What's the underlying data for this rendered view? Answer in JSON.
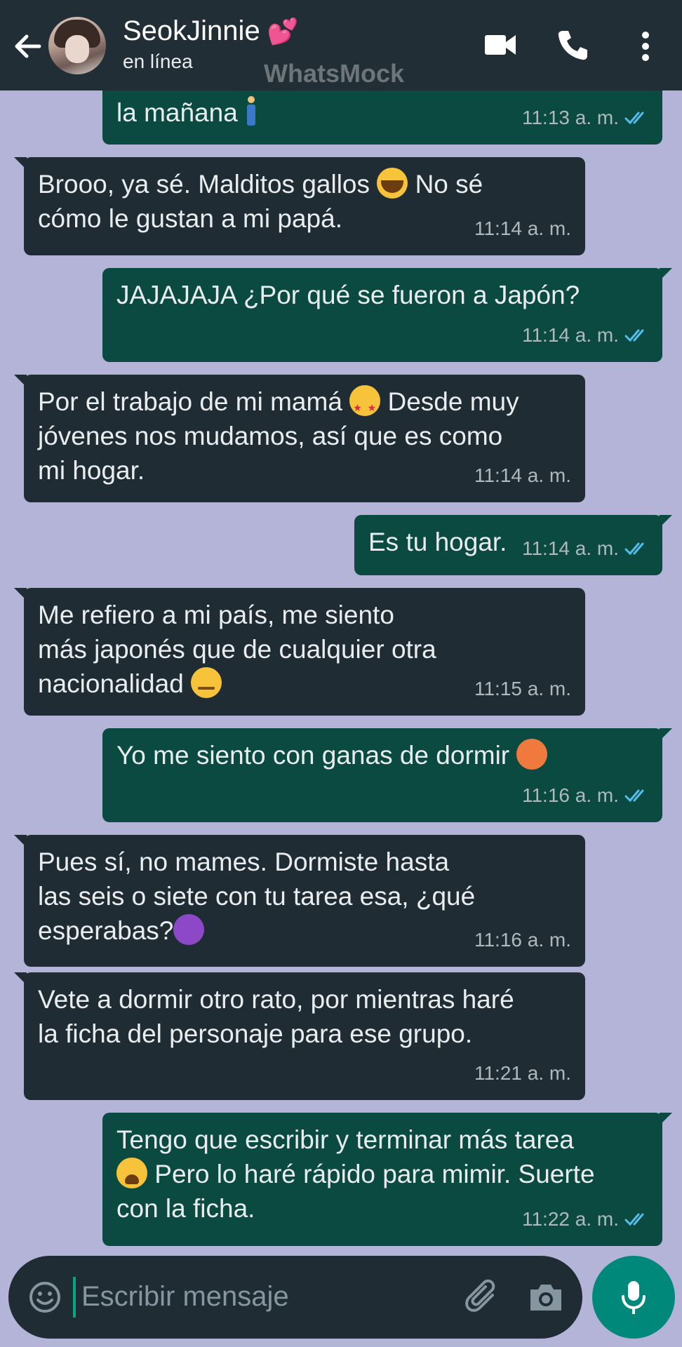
{
  "header": {
    "contact_name": "SeokJinnie",
    "name_emoji": "💕",
    "status": "en línea",
    "watermark": "WhatsMock"
  },
  "messages": [
    {
      "dir": "out",
      "text": "la mañana",
      "emoji": "person",
      "time": "11:13 a. m.",
      "ticks": true
    },
    {
      "dir": "in",
      "text": "Brooo, ya sé. Malditos gallos 😭 No sé\ncómo le gustan a mi papá.",
      "time": "11:14 a. m."
    },
    {
      "dir": "out",
      "text": "JAJAJAJA ¿Por qué se fueron a Japón?",
      "time": "11:14 a. m.",
      "ticks": true
    },
    {
      "dir": "in",
      "text": "Por el trabajo de mi mamá 🤩 Desde muy\njóvenes nos mudamos, así que es como\nmi hogar.",
      "time": "11:14 a. m."
    },
    {
      "dir": "out",
      "text": "Es tu hogar.",
      "time": "11:14 a. m.",
      "ticks": true
    },
    {
      "dir": "in",
      "text": "Me refiero a mi país, me siento\nmás japonés que de cualquier otra\nnacionalidad 🥴",
      "time": "11:15 a. m."
    },
    {
      "dir": "out",
      "text": "Yo me siento con ganas de dormir 🥵",
      "time": "11:16 a. m.",
      "ticks": true
    },
    {
      "dir": "in",
      "text": "Pues sí, no mames. Dormiste hasta\nlas seis o siete con tu tarea esa, ¿qué\nesperabas?👿",
      "time": "11:16 a. m."
    },
    {
      "dir": "in",
      "text": "Vete a dormir otro rato, por mientras haré\nla ficha del personaje para ese grupo.",
      "time": "11:21 a. m."
    },
    {
      "dir": "out",
      "text": "Tengo que escribir y terminar más tarea\n😩 Pero lo haré rápido para mimir. Suerte\ncon la ficha.",
      "time": "11:22 a. m.",
      "ticks": true
    }
  ],
  "input": {
    "placeholder": "Escribir mensaje"
  },
  "colors": {
    "background": "#b4b3d8",
    "header": "#222e35",
    "incoming": "#202c33",
    "outgoing": "#0b4a40",
    "accent": "#00897b",
    "ticks": "#53bdeb"
  },
  "icons": [
    "back-arrow-icon",
    "video-call-icon",
    "phone-icon",
    "more-options-icon",
    "emoji-icon",
    "attach-clip-icon",
    "camera-icon",
    "mic-icon",
    "double-check-icon"
  ]
}
